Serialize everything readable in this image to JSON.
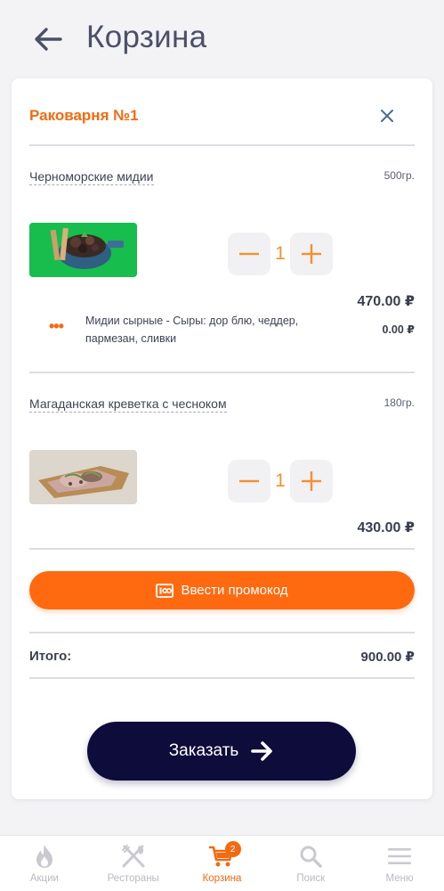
{
  "header": {
    "title": "Корзина"
  },
  "cart": {
    "restaurant": "Раковарня №1",
    "items": [
      {
        "name": "Черноморские мидии",
        "weight": "500гр.",
        "quantity": "1",
        "price": "470.00 ₽",
        "modifier": {
          "text": "Мидии сырные - Сыры: дор блю, чеддер, пармезан, сливки",
          "price": "0.00 ₽"
        }
      },
      {
        "name": "Магаданская креветка с чесноком",
        "weight": "180гр.",
        "quantity": "1",
        "price": "430.00 ₽"
      }
    ],
    "promo_label": "Ввести промокод",
    "total_label": "Итого:",
    "total_value": "900.00 ₽",
    "order_label": "Заказать"
  },
  "nav": {
    "items": [
      {
        "label": "Акции",
        "icon": "flame-icon"
      },
      {
        "label": "Рестораны",
        "icon": "fork-knife-icon"
      },
      {
        "label": "Корзина",
        "icon": "cart-icon",
        "badge": "2"
      },
      {
        "label": "Поиск",
        "icon": "search-icon"
      },
      {
        "label": "Меню",
        "icon": "menu-icon"
      }
    ],
    "active": "Корзина"
  },
  "colors": {
    "accent": "#ff6a10",
    "order_button": "#0e0c3a",
    "inactive": "#b9bac2"
  }
}
